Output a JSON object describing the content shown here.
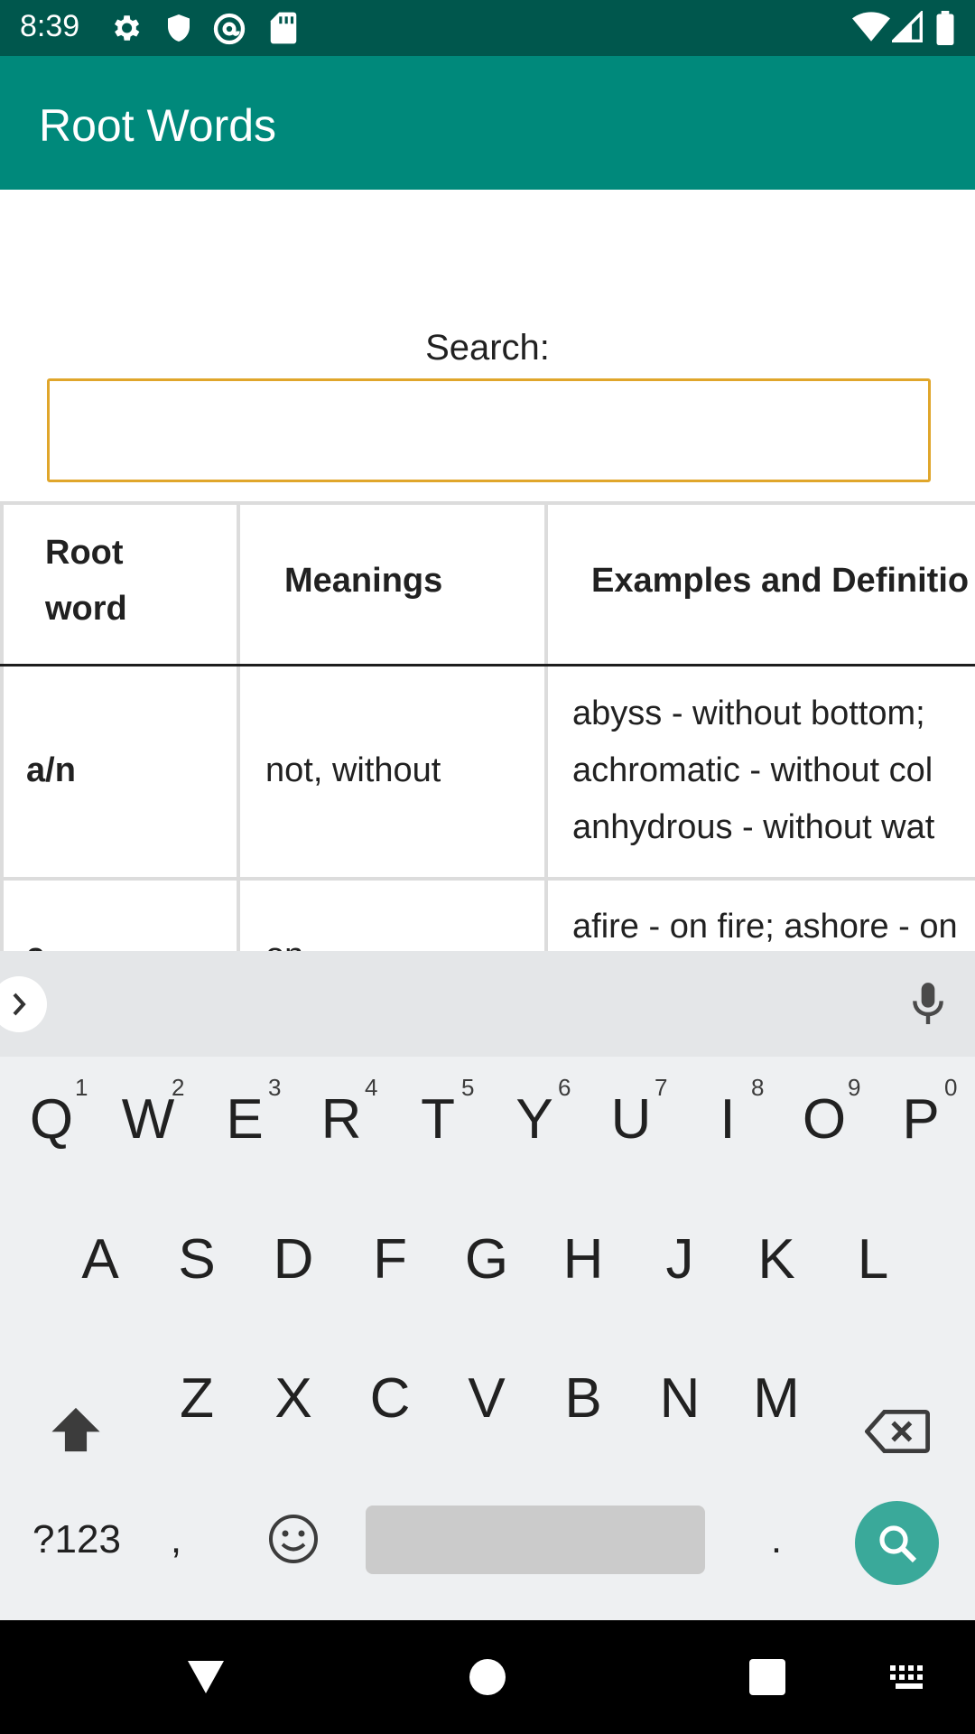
{
  "status_bar": {
    "time": "8:39",
    "left_icons": [
      "gear-icon",
      "shield-icon",
      "at-sign-icon",
      "sd-card-icon"
    ],
    "right_icons": [
      "wifi-icon",
      "signal-icon",
      "battery-icon"
    ]
  },
  "app_bar": {
    "title": "Root Words",
    "color": "#00897b"
  },
  "search": {
    "label": "Search:",
    "value": "",
    "focus_color": "#e0a62b"
  },
  "table": {
    "headers": [
      "Root word",
      "Meanings",
      "Examples and Definitio"
    ],
    "rows": [
      {
        "root": "a/n",
        "meaning": "not, without",
        "examples": [
          "abyss - without bottom;",
          "achromatic - without col",
          "anhydrous - without wat"
        ]
      },
      {
        "root": "a",
        "meaning": "on",
        "examples": [
          "afire - on fire; ashore - on"
        ]
      }
    ]
  },
  "keyboard": {
    "row1": [
      {
        "key": "Q",
        "hint": "1"
      },
      {
        "key": "W",
        "hint": "2"
      },
      {
        "key": "E",
        "hint": "3"
      },
      {
        "key": "R",
        "hint": "4"
      },
      {
        "key": "T",
        "hint": "5"
      },
      {
        "key": "Y",
        "hint": "6"
      },
      {
        "key": "U",
        "hint": "7"
      },
      {
        "key": "I",
        "hint": "8"
      },
      {
        "key": "O",
        "hint": "9"
      },
      {
        "key": "P",
        "hint": "0"
      }
    ],
    "row2": [
      "A",
      "S",
      "D",
      "F",
      "G",
      "H",
      "J",
      "K",
      "L"
    ],
    "row3": [
      "Z",
      "X",
      "C",
      "V",
      "B",
      "N",
      "M"
    ],
    "symbols_label": "?123",
    "comma": ",",
    "period": ".",
    "accent": "#3aa99a"
  },
  "nav_bar": {
    "icons": [
      "back-icon",
      "home-icon",
      "recents-icon",
      "keyboard-switch-icon"
    ]
  }
}
